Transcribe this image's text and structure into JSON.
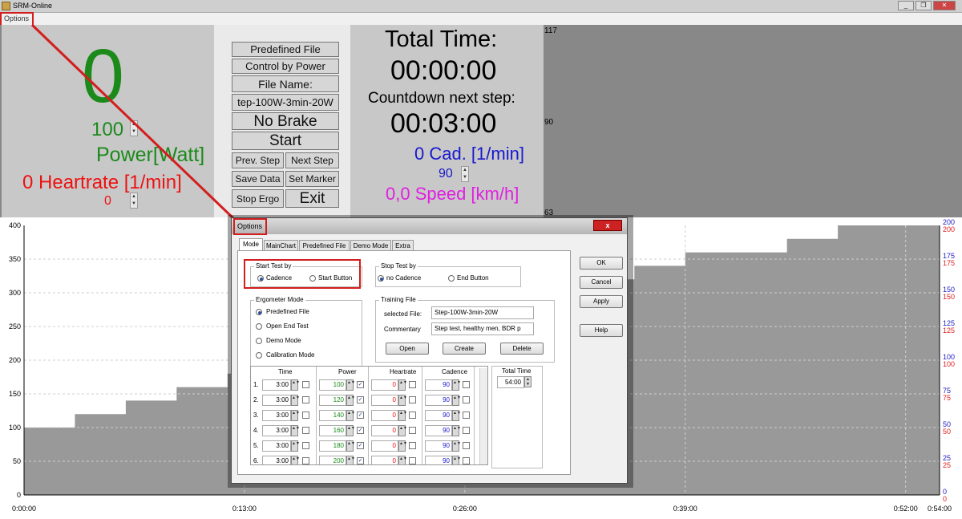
{
  "window": {
    "title": "SRM-Online"
  },
  "menubar": {
    "options": "Options"
  },
  "left_panel": {
    "power_big": "0",
    "power_setpoint": "100",
    "power_label": "Power[Watt]",
    "heartrate_label": "0 Heartrate [1/min]",
    "heartrate_setpoint": "0"
  },
  "button_panel": {
    "predefined_file": "Predefined File",
    "control_by_power": "Control by Power",
    "file_name_label": "File Name:",
    "file_name_value": "tep-100W-3min-20W",
    "no_brake": "No Brake",
    "start": "Start",
    "prev_step": "Prev. Step",
    "next_step": "Next Step",
    "save_data": "Save Data",
    "set_marker": "Set Marker",
    "stop_ergo": "Stop Ergo",
    "exit": "Exit"
  },
  "time_panel": {
    "total_time_label": "Total Time:",
    "total_time_value": "00:00:00",
    "countdown_label": "Countdown next step:",
    "countdown_value": "00:03:00",
    "cadence_label": "0 Cad. [1/min]",
    "cadence_setpoint": "90",
    "speed_label": "0,0 Speed [km/h]"
  },
  "hr_axis_labels": [
    "117",
    "90",
    "63"
  ],
  "chart_data": {
    "type": "area",
    "title": "",
    "xlabel": "",
    "ylabel": "",
    "x_ticks": [
      "0:00:00",
      "0:13:00",
      "0:26:00",
      "0:39:00",
      "0:52:00",
      "0:54:00"
    ],
    "y_ticks_left": [
      "0",
      "50",
      "100",
      "150",
      "200",
      "250",
      "300",
      "350",
      "400"
    ],
    "y_ticks_right_red": [
      "0",
      "25",
      "50",
      "75",
      "100",
      "125",
      "150",
      "175",
      "200"
    ],
    "y_ticks_right_blue": [
      "0",
      "25",
      "50",
      "75",
      "100",
      "125",
      "150",
      "175",
      "200"
    ],
    "ylim": [
      0,
      400
    ],
    "xlim_minutes": [
      0,
      54
    ],
    "grid": true,
    "series": [
      {
        "values": [
          {
            "x": 0,
            "y": 100
          },
          {
            "x": 3,
            "y": 120
          },
          {
            "x": 6,
            "y": 140
          },
          {
            "x": 9,
            "y": 160
          },
          {
            "x": 12,
            "y": 180
          },
          {
            "x": 15,
            "y": 200
          },
          {
            "x": 18,
            "y": 220
          },
          {
            "x": 21,
            "y": 240
          },
          {
            "x": 24,
            "y": 260
          },
          {
            "x": 27,
            "y": 280
          },
          {
            "x": 30,
            "y": 300
          },
          {
            "x": 33,
            "y": 320
          },
          {
            "x": 36,
            "y": 340
          },
          {
            "x": 39,
            "y": 360
          },
          {
            "x": 42,
            "y": 360
          },
          {
            "x": 45,
            "y": 380
          },
          {
            "x": 48,
            "y": 400
          },
          {
            "x": 51,
            "y": 420
          },
          {
            "x": 54,
            "y": 420
          }
        ]
      }
    ],
    "colors": {
      "area": "#999999",
      "left_axis": "#000000",
      "right_red": "#e02020",
      "right_blue": "#2020c0"
    }
  },
  "dialog": {
    "title": "Options",
    "close": "x",
    "tabs": [
      "Mode",
      "MainChart",
      "Predefined File",
      "Demo Mode",
      "Extra"
    ],
    "start_test": {
      "title": "Start Test by",
      "options": [
        "Cadence",
        "Start Button"
      ],
      "selected": "Cadence"
    },
    "stop_test": {
      "title": "Stop Test by",
      "options": [
        "no Cadence",
        "End Button"
      ],
      "selected": "no Cadence"
    },
    "ergometer_mode": {
      "title": "Ergometer Mode",
      "options": [
        "Predefined File",
        "Open End Test",
        "Demo Mode",
        "Calibration Mode"
      ],
      "selected": "Predefined File"
    },
    "training_file": {
      "title": "Training File",
      "selected_file_label": "selected File:",
      "selected_file_value": "Step-100W-3min-20W",
      "commentary_label": "Commentary",
      "commentary_value": "Step test, healthy men, BDR p",
      "open": "Open",
      "create": "Create",
      "delete": "Delete"
    },
    "table": {
      "headers": [
        "Time",
        "Power",
        "Heartrate",
        "Cadence"
      ],
      "rows": [
        {
          "n": "1.",
          "time": "3:00",
          "power": "100",
          "power_checked": true,
          "hr": "0",
          "cad": "90"
        },
        {
          "n": "2.",
          "time": "3:00",
          "power": "120",
          "power_checked": true,
          "hr": "0",
          "cad": "90"
        },
        {
          "n": "3.",
          "time": "3:00",
          "power": "140",
          "power_checked": true,
          "hr": "0",
          "cad": "90"
        },
        {
          "n": "4.",
          "time": "3:00",
          "power": "160",
          "power_checked": true,
          "hr": "0",
          "cad": "90"
        },
        {
          "n": "5.",
          "time": "3:00",
          "power": "180",
          "power_checked": true,
          "hr": "0",
          "cad": "90"
        },
        {
          "n": "6.",
          "time": "3:00",
          "power": "200",
          "power_checked": true,
          "hr": "0",
          "cad": "90"
        }
      ]
    },
    "total_time": {
      "label": "Total Time",
      "value": "54:00"
    },
    "buttons": {
      "ok": "OK",
      "cancel": "Cancel",
      "apply": "Apply",
      "help": "Help"
    }
  }
}
